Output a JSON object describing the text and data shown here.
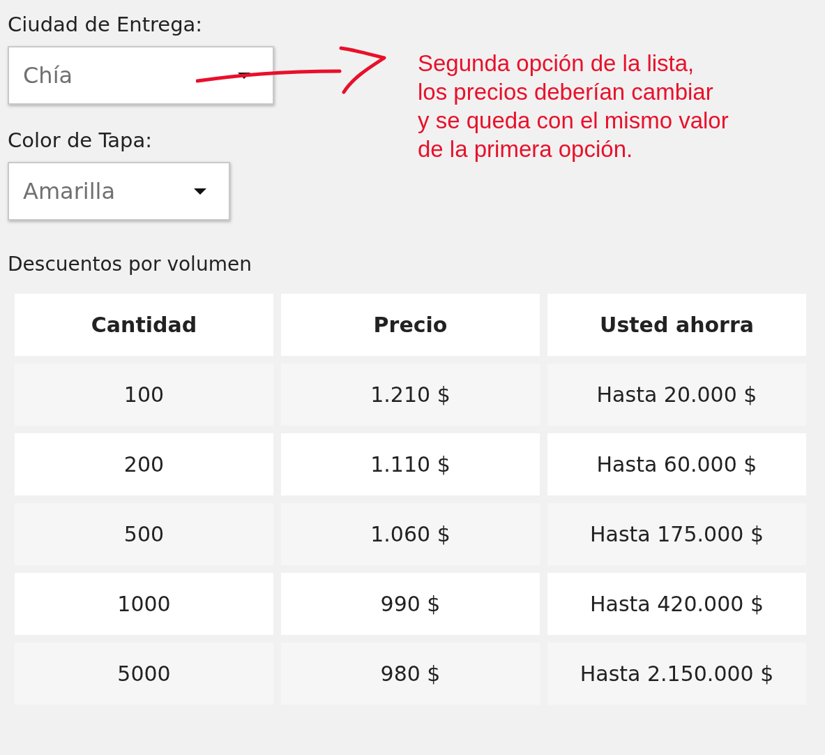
{
  "fields": [
    {
      "label": "Ciudad de Entrega:",
      "value": "Chía"
    },
    {
      "label": "Color de Tapa:",
      "value": "Amarilla"
    }
  ],
  "annotation": {
    "text": "Segunda opción de la lista,\nlos precios deberían cambiar\ny se queda con el mismo valor\nde la primera opción."
  },
  "discounts": {
    "title": "Descuentos por volumen",
    "columns": [
      "Cantidad",
      "Precio",
      "Usted ahorra"
    ],
    "rows": [
      [
        "100",
        "1.210 $",
        "Hasta 20.000 $"
      ],
      [
        "200",
        "1.110 $",
        "Hasta 60.000 $"
      ],
      [
        "500",
        "1.060 $",
        "Hasta 175.000 $"
      ],
      [
        "1000",
        "990 $",
        "Hasta 420.000 $"
      ],
      [
        "5000",
        "980 $",
        "Hasta 2.150.000 $"
      ]
    ]
  }
}
